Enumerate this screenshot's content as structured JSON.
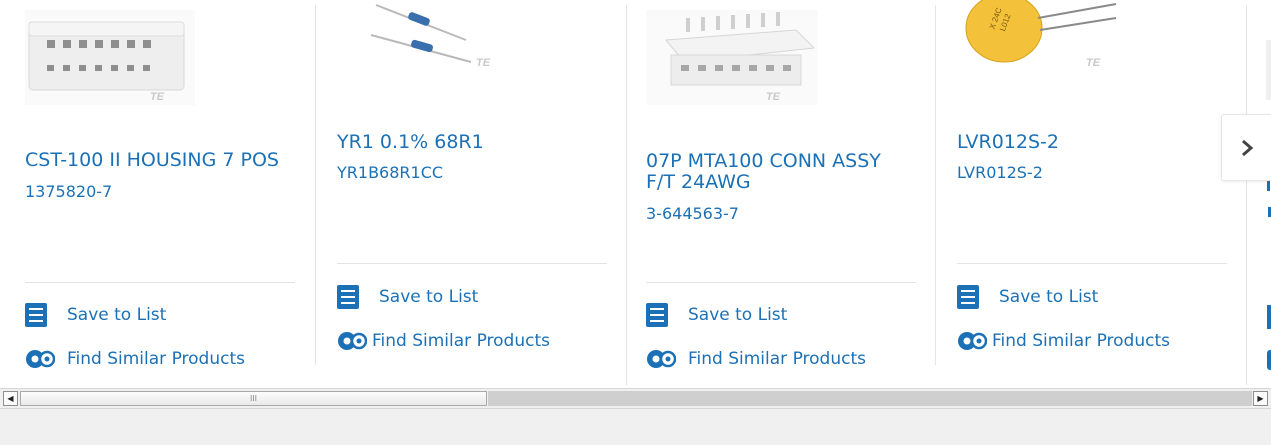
{
  "products": [
    {
      "title": "CST-100 II HOUSING 7 POS",
      "part_number": "1375820-7",
      "save_label": "Save to List",
      "similar_label": "Find Similar Products",
      "thumb_icon": "connector-housing-image",
      "brand": "TE"
    },
    {
      "title": "YR1 0.1% 68R1",
      "part_number": "YR1B68R1CC",
      "save_label": "Save to List",
      "similar_label": "Find Similar Products",
      "thumb_icon": "resistor-image",
      "brand": "TE"
    },
    {
      "title_line1": "07P MTA100 CONN ASSY",
      "title_line2": "F/T 24AWG",
      "part_number": "3-644563-7",
      "save_label": "Save to List",
      "similar_label": "Find Similar Products",
      "thumb_icon": "connector-assembly-image",
      "brand": "TE"
    },
    {
      "title": "LVR012S-2",
      "part_number": "LVR012S-2",
      "save_label": "Save to List",
      "similar_label": "Find Similar Products",
      "thumb_icon": "ptc-resettable-device-image",
      "brand": "TE"
    }
  ],
  "carousel": {
    "next_icon": "chevron-right-icon"
  },
  "scrollbar": {
    "left_arrow": "◀",
    "right_arrow": "▶",
    "grip": "III"
  },
  "colors": {
    "link": "#1c71b6",
    "divider": "#e4e4e4",
    "scrollbar_bg": "#f0f0f0"
  }
}
